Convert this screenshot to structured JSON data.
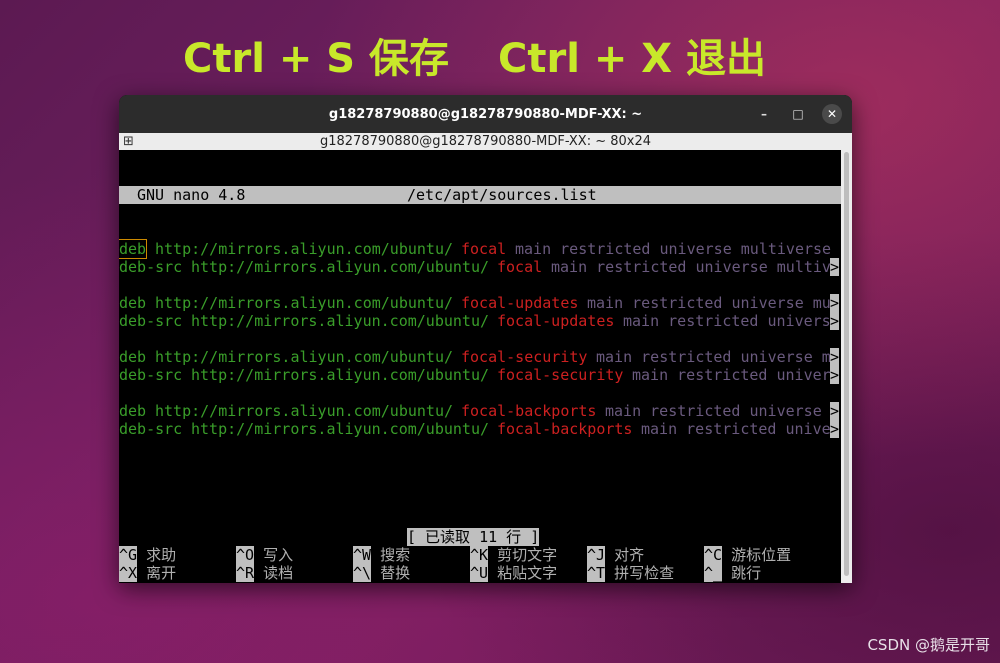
{
  "hints": {
    "save": "Ctrl + S 保存",
    "exit": "Ctrl + X 退出"
  },
  "window": {
    "title": "g18278790880@g18278790880-MDF-XX: ~",
    "subtitle": "g18278790880@g18278790880-MDF-XX: ~ 80x24",
    "buttons": {
      "minimize": "–",
      "maximize": "□",
      "close": "✕"
    }
  },
  "nano": {
    "version": "GNU nano 4.8",
    "file": "/etc/apt/sources.list",
    "status": "[ 已读取 11 行 ]",
    "lines": [
      {
        "type": "deb",
        "url": "http://mirrors.aliyun.com/ubuntu/",
        "dist": "focal",
        "comps": "main restricted universe multiverse",
        "more": ""
      },
      {
        "type": "deb-src",
        "url": "http://mirrors.aliyun.com/ubuntu/",
        "dist": "focal",
        "comps": "main restricted universe multiv",
        "more": ">"
      },
      {
        "type": "",
        "url": "",
        "dist": "",
        "comps": "",
        "more": ""
      },
      {
        "type": "deb",
        "url": "http://mirrors.aliyun.com/ubuntu/",
        "dist": "focal-updates",
        "comps": "main restricted universe mu",
        "more": ">"
      },
      {
        "type": "deb-src",
        "url": "http://mirrors.aliyun.com/ubuntu/",
        "dist": "focal-updates",
        "comps": "main restricted univers",
        "more": ">"
      },
      {
        "type": "",
        "url": "",
        "dist": "",
        "comps": "",
        "more": ""
      },
      {
        "type": "deb",
        "url": "http://mirrors.aliyun.com/ubuntu/",
        "dist": "focal-security",
        "comps": "main restricted universe m",
        "more": ">"
      },
      {
        "type": "deb-src",
        "url": "http://mirrors.aliyun.com/ubuntu/",
        "dist": "focal-security",
        "comps": "main restricted univer",
        "more": ">"
      },
      {
        "type": "",
        "url": "",
        "dist": "",
        "comps": "",
        "more": ""
      },
      {
        "type": "deb",
        "url": "http://mirrors.aliyun.com/ubuntu/",
        "dist": "focal-backports",
        "comps": "main restricted universe ",
        "more": ">"
      },
      {
        "type": "deb-src",
        "url": "http://mirrors.aliyun.com/ubuntu/",
        "dist": "focal-backports",
        "comps": "main restricted unive",
        "more": ">"
      }
    ],
    "shortcuts": [
      {
        "key": "^G",
        "label": "求助"
      },
      {
        "key": "^O",
        "label": "写入"
      },
      {
        "key": "^W",
        "label": "搜索"
      },
      {
        "key": "^K",
        "label": "剪切文字"
      },
      {
        "key": "^J",
        "label": "对齐"
      },
      {
        "key": "^C",
        "label": "游标位置"
      },
      {
        "key": "^X",
        "label": "离开"
      },
      {
        "key": "^R",
        "label": "读档"
      },
      {
        "key": "^\\",
        "label": "替换"
      },
      {
        "key": "^U",
        "label": "粘贴文字"
      },
      {
        "key": "^T",
        "label": "拼写检查"
      },
      {
        "key": "^_",
        "label": "跳行"
      }
    ]
  },
  "watermark": "CSDN @鹅是开哥"
}
